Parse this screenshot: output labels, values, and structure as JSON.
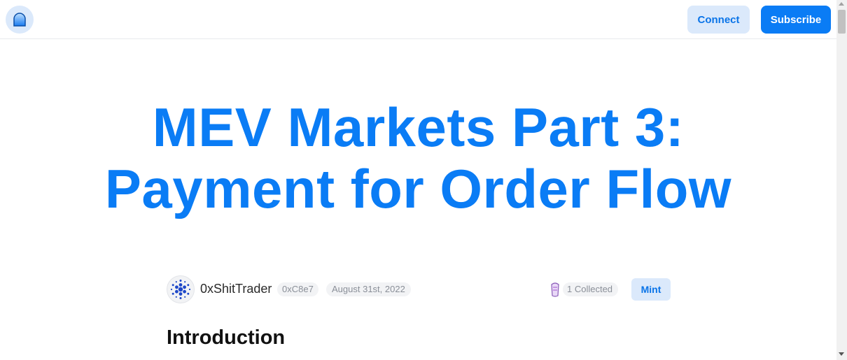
{
  "header": {
    "logo_icon": "mirror-logo-icon",
    "connect_label": "Connect",
    "subscribe_label": "Subscribe"
  },
  "article": {
    "title_line1": "MEV Markets Part 3:",
    "title_line2": "Payment for Order Flow",
    "author": "0xShitTrader",
    "address": "0xC8e7",
    "date": "August 31st, 2022",
    "collected": "1 Collected",
    "mint_label": "Mint",
    "section_heading": "Introduction"
  },
  "colors": {
    "accent": "#0a7cf5",
    "accent_light": "#dbe9fb",
    "pill_bg": "#f2f3f5"
  }
}
